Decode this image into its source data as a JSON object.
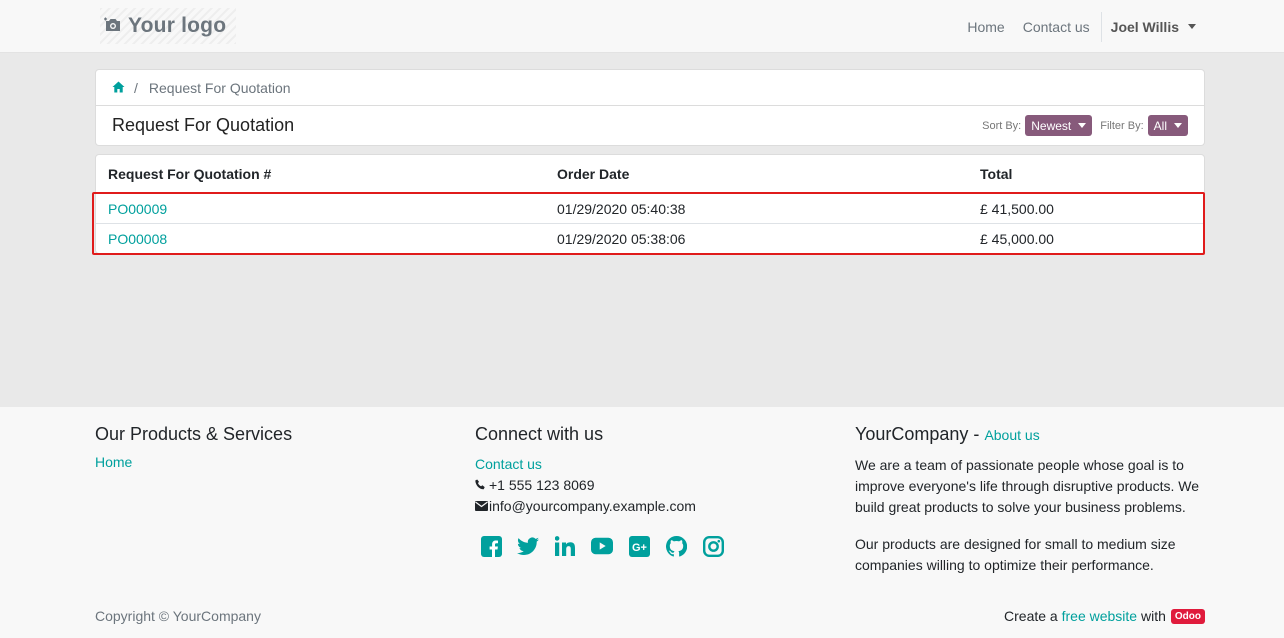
{
  "header": {
    "logo_text": "Your logo",
    "nav": [
      "Home",
      "Contact us"
    ],
    "user_name": "Joel Willis"
  },
  "breadcrumb": {
    "sep": "/",
    "current": "Request For Quotation"
  },
  "page": {
    "title": "Request For Quotation",
    "sort_label": "Sort By:",
    "sort_value": "Newest",
    "filter_label": "Filter By:",
    "filter_value": "All"
  },
  "table": {
    "headers": [
      "Request For Quotation #",
      "Order Date",
      "Total"
    ],
    "rows": [
      {
        "ref": "PO00009",
        "date": "01/29/2020 05:40:38",
        "total": "£ 41,500.00"
      },
      {
        "ref": "PO00008",
        "date": "01/29/2020 05:38:06",
        "total": "£ 45,000.00"
      }
    ]
  },
  "footer": {
    "col1_title": "Our Products & Services",
    "col1_link": "Home",
    "col2_title": "Connect with us",
    "contact_link": "Contact us",
    "phone": "+1 555 123 8069",
    "email": "info@yourcompany.example.com",
    "social_icons": [
      "facebook-icon",
      "twitter-icon",
      "linkedin-icon",
      "youtube-icon",
      "google-plus-icon",
      "github-icon",
      "instagram-icon"
    ],
    "col3_company": "YourCompany",
    "col3_dash": "-",
    "col3_about": "About us",
    "about_p1": "We are a team of passionate people whose goal is to improve everyone's life through disruptive products. We build great products to solve your business problems.",
    "about_p2": "Our products are designed for small to medium size companies willing to optimize their performance.",
    "copyright": "Copyright © YourCompany",
    "credit_prefix": "Create a",
    "credit_link": "free website",
    "credit_with": "with",
    "credit_badge": "Odoo"
  },
  "colors": {
    "accent": "#00A09D",
    "primary": "#875A7B",
    "highlight": "#e01b1b"
  }
}
